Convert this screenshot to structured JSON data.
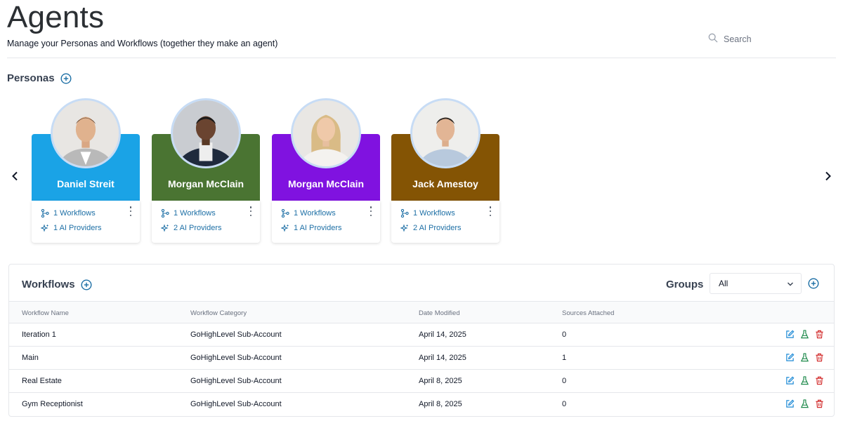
{
  "header": {
    "title": "Agents",
    "subtitle": "Manage your Personas and Workflows (together they make an agent)",
    "search_placeholder": "Search"
  },
  "personas": {
    "title": "Personas",
    "items": [
      {
        "name": "Daniel  Streit",
        "color": "#1aa3e6",
        "workflows": "1 Workflows",
        "providers": "1 AI Providers"
      },
      {
        "name": "Morgan McClain",
        "color": "#4a7432",
        "workflows": "1 Workflows",
        "providers": "2 AI Providers"
      },
      {
        "name": "Morgan McClain",
        "color": "#8012e0",
        "workflows": "1 Workflows",
        "providers": "1 AI Providers"
      },
      {
        "name": "Jack Amestoy",
        "color": "#845404",
        "workflows": "1 Workflows",
        "providers": "2 AI Providers"
      }
    ]
  },
  "workflows": {
    "title": "Workflows",
    "groups_label": "Groups",
    "groups_value": "All",
    "columns": [
      "Workflow Name",
      "Workflow Category",
      "Date Modified",
      "Sources Attached"
    ],
    "rows": [
      {
        "name": "Iteration 1",
        "category": "GoHighLevel Sub-Account",
        "date": "April 14, 2025",
        "sources": "0"
      },
      {
        "name": "Main",
        "category": "GoHighLevel Sub-Account",
        "date": "April 14, 2025",
        "sources": "1"
      },
      {
        "name": "Real Estate",
        "category": "GoHighLevel Sub-Account",
        "date": "April 8, 2025",
        "sources": "0"
      },
      {
        "name": "Gym Receptionist",
        "category": "GoHighLevel Sub-Account",
        "date": "April 8, 2025",
        "sources": "0"
      }
    ]
  },
  "colors": {
    "link_blue": "#1d6fa5",
    "edit_icon": "#1d8ad6",
    "test_icon": "#1f8a4c",
    "delete_icon": "#d32f2f"
  }
}
